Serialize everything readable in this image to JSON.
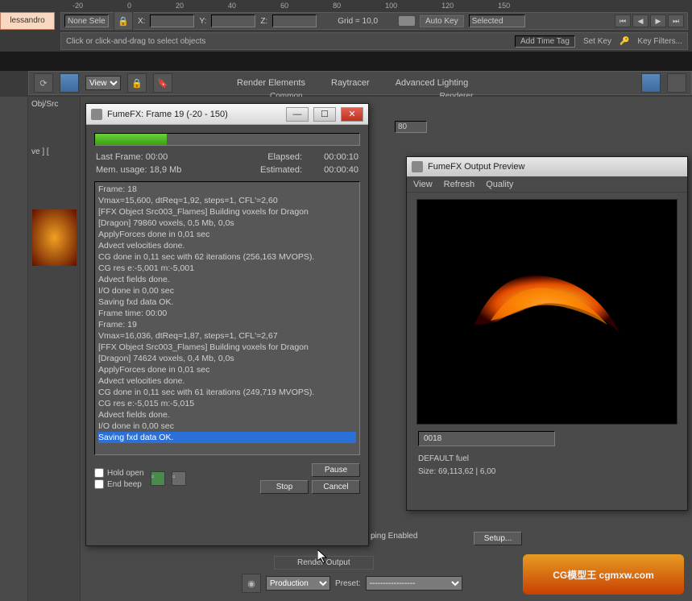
{
  "ruler": [
    "-20",
    "0",
    "20",
    "40",
    "60",
    "80",
    "100",
    "120",
    "150"
  ],
  "tab_name": "lessandro",
  "top": {
    "selection": "None Sele",
    "x_label": "X:",
    "y_label": "Y:",
    "z_label": "Z:",
    "grid_label": "Grid = 10,0",
    "autokey": "Auto Key",
    "selected": "Selected",
    "setkey": "Set Key",
    "keyfilters": "Key Filters..."
  },
  "status": {
    "msg": "Click or click-and-drag to select objects",
    "tag": "Add Time Tag"
  },
  "toolbar2": {
    "view_dropdown": "View",
    "tabs": [
      "Render Elements",
      "Raytracer",
      "Advanced Lighting"
    ],
    "tabs2": [
      "Common",
      "Renderer"
    ]
  },
  "left_panel": {
    "label": "Obj/Src",
    "tab2": "ve ] ["
  },
  "spinner1": "80",
  "fumefx": {
    "title": "FumeFX: Frame 19 (-20 - 150)",
    "progress_pct": 27,
    "last_frame_label": "Last Frame:",
    "last_frame": "00:00",
    "elapsed_label": "Elapsed:",
    "elapsed": "00:00:10",
    "mem_label": "Mem. usage:",
    "mem": "18,9 Mb",
    "est_label": "Estimated:",
    "est": "00:00:40",
    "log": [
      "Frame: 18",
      "Vmax=15,600, dtReq=1,92, steps=1, CFL'=2,60",
      "[FFX Object Src003_Flames] Building voxels for Dragon",
      "[Dragon] 79860 voxels, 0,5 Mb, 0,0s",
      "ApplyForces done in 0,01 sec",
      "Advect velocities done.",
      "CG done in 0,11 sec with 62 iterations (256,163 MVOPS).",
      "CG res e:-5,001 m:-5,001",
      "Advect fields done.",
      "I/O done in 0,00 sec",
      "Saving fxd data OK.",
      "Frame time: 00:00",
      "",
      "Frame: 19",
      "Vmax=16,036, dtReq=1,87, steps=1, CFL'=2,67",
      "[FFX Object Src003_Flames] Building voxels for Dragon",
      "[Dragon] 74624 voxels, 0,4 Mb, 0,0s",
      "ApplyForces done in 0,01 sec",
      "Advect velocities done.",
      "CG done in 0,11 sec with 61 iterations (249,719 MVOPS).",
      "CG res e:-5,015 m:-5,015",
      "Advect fields done.",
      "I/O done in 0,00 sec"
    ],
    "log_selected": "Saving fxd data OK.",
    "hold_open": "Hold open",
    "end_beep": "End beep",
    "pause": "Pause",
    "stop": "Stop",
    "cancel": "Cancel"
  },
  "preview": {
    "title": "FumeFX Output Preview",
    "menu": [
      "View",
      "Refresh",
      "Quality"
    ],
    "frame": "0018",
    "fuel": "DEFAULT fuel",
    "size": "Size: 69,113,62 | 6,00"
  },
  "bottom": {
    "setup": "Setup...",
    "render_output": "Render Output",
    "production": "Production",
    "preset_label": "Preset:",
    "ping_enabled": "ping Enabled"
  }
}
